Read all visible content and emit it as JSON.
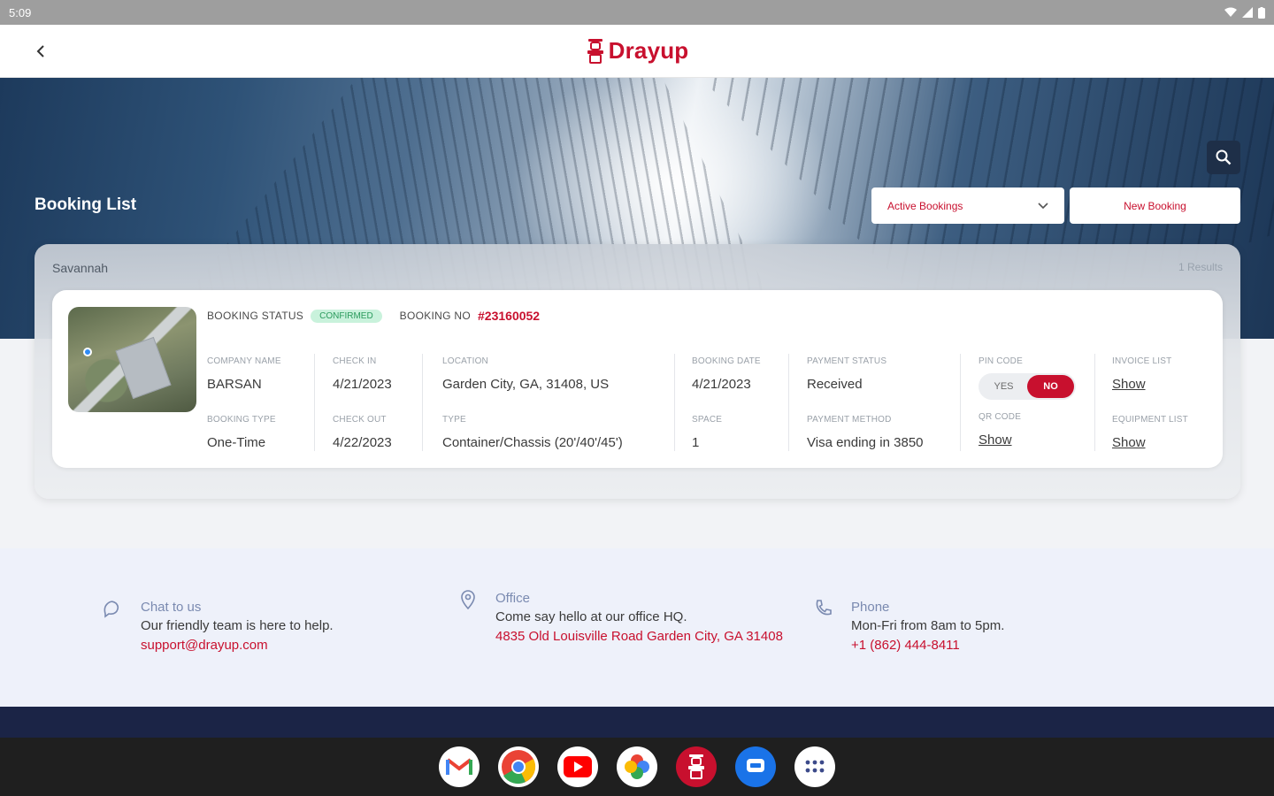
{
  "status_bar": {
    "time": "5:09"
  },
  "app": {
    "brand": "Drayup"
  },
  "header": {
    "page_title": "Booking List",
    "filter_selected": "Active Bookings",
    "new_booking_label": "New Booking"
  },
  "results": {
    "group": "Savannah",
    "count_text": "1 Results"
  },
  "booking": {
    "status_label": "BOOKING STATUS",
    "status": "CONFIRMED",
    "booking_no_label": "BOOKING NO",
    "booking_no": "#23160052",
    "fields": {
      "company_name": {
        "label": "COMPANY NAME",
        "value": "BARSAN"
      },
      "booking_type": {
        "label": "BOOKING TYPE",
        "value": "One-Time"
      },
      "check_in": {
        "label": "CHECK IN",
        "value": "4/21/2023"
      },
      "check_out": {
        "label": "CHECK OUT",
        "value": "4/22/2023"
      },
      "location": {
        "label": "LOCATION",
        "value": "Garden City, GA, 31408, US"
      },
      "type": {
        "label": "TYPE",
        "value": "Container/Chassis (20'/40'/45')"
      },
      "booking_date": {
        "label": "BOOKING DATE",
        "value": "4/21/2023"
      },
      "space": {
        "label": "SPACE",
        "value": "1"
      },
      "payment_status": {
        "label": "PAYMENT STATUS",
        "value": "Received"
      },
      "payment_method": {
        "label": "PAYMENT METHOD",
        "value": "Visa ending in 3850"
      },
      "pin_code": {
        "label": "PIN CODE",
        "yes": "YES",
        "no": "NO",
        "selected": "NO"
      },
      "qr_code": {
        "label": "QR CODE",
        "link": "Show"
      },
      "invoice_list": {
        "label": "INVOICE LIST",
        "link": "Show"
      },
      "equipment_list": {
        "label": "EQUIPMENT LIST",
        "link": "Show"
      }
    }
  },
  "contact": {
    "chat": {
      "title": "Chat to us",
      "text": "Our friendly team is here to help.",
      "link": "support@drayup.com"
    },
    "office": {
      "title": "Office",
      "text": "Come say hello at our office HQ.",
      "link": "4835 Old Louisville Road Garden City, GA 31408"
    },
    "phone": {
      "title": "Phone",
      "text": "Mon-Fri from 8am to 5pm.",
      "link": "+1 (862) 444-8411"
    }
  },
  "dock": {
    "apps": [
      "gmail-icon",
      "chrome-icon",
      "youtube-icon",
      "photos-icon",
      "drayup-icon",
      "messages-icon",
      "app-launcher-icon"
    ]
  },
  "colors": {
    "brand_red": "#c8102e",
    "navy": "#1b2446",
    "confirmed_green": "#2a9a5c"
  }
}
